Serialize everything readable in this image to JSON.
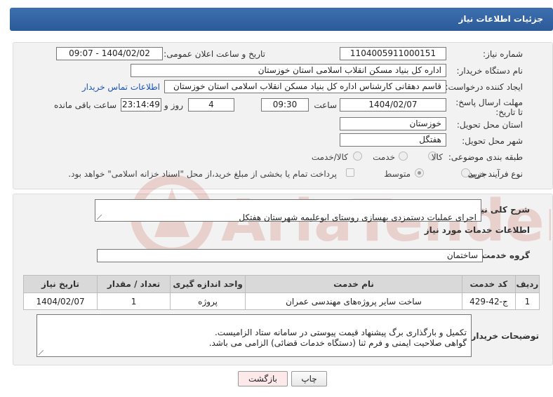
{
  "header": {
    "title": "جزئیات اطلاعات نیاز"
  },
  "form": {
    "need_number_label": "شماره نیاز:",
    "need_number": "1104005911000151",
    "announce_label": "تاریخ و ساعت اعلان عمومی:",
    "announce_value": "1404/02/02 - 09:07",
    "buyer_label": "نام دستگاه خریدار:",
    "buyer_value": "اداره کل بنیاد مسکن انقلاب اسلامی استان خوزستان",
    "creator_label": "ایجاد کننده درخواست:",
    "creator_value": "قاسم دهقانی کارشناس اداره کل بنیاد مسکن انقلاب اسلامی استان خوزستان",
    "contact_link": "اطلاعات تماس خریدار",
    "deadline_label": "مهلت ارسال پاسخ: تا تاریخ:",
    "deadline_date": "1404/02/07",
    "time_label": "ساعت",
    "deadline_time": "09:30",
    "days_value": "4",
    "days_label": "روز و",
    "remaining_value": "23:14:49",
    "remaining_label": "ساعت باقی مانده",
    "province_label": "استان محل تحویل:",
    "province_value": "خوزستان",
    "city_label": "شهر محل تحویل:",
    "city_value": "هفتگل",
    "category_label": "طبقه بندی موضوعی:",
    "category_options": [
      "کالا",
      "خدمت",
      "کالا/خدمت"
    ],
    "category_selected": "خدمت",
    "process_label": "نوع فرآیند خرید :",
    "process_options": [
      "جزیی",
      "متوسط"
    ],
    "process_selected": "متوسط",
    "payment_note": "پرداخت تمام یا بخشی از مبلغ خرید،از محل \"اسناد خزانه اسلامی\" خواهد بود."
  },
  "details": {
    "description_label": "شرح کلی نیاز:",
    "description_value": "اجرای عملیات دستمزدی بهسازی روستای ابوعلیمه شهرستان هفتکل",
    "services_heading": "اطلاعات خدمات مورد نیاز",
    "service_group_label": "گروه خدمت:",
    "service_group_value": "ساختمان",
    "table": {
      "headers": [
        "ردیف",
        "کد خدمت",
        "نام خدمت",
        "واحد اندازه گیری",
        "تعداد / مقدار",
        "تاریخ نیاز"
      ],
      "rows": [
        [
          "1",
          "ج-42-429",
          "ساخت سایر پروژه‌های مهندسی عمران",
          "پروژه",
          "1",
          "1404/02/07"
        ]
      ]
    },
    "buyer_notes_label": "توضیحات خریدار:",
    "buyer_notes_value": "تکمیل و بارگذاری برگ پیشنهاد قیمت پیوستی در سامانه ستاد الزامیست.\nگواهی صلاحیت ایمنی و فرم ثنا (دستگاه خدمات قضائی) الزامی می باشد."
  },
  "buttons": {
    "print": "چاپ",
    "back": "بازگشت"
  },
  "watermark_text": "AriaTender.net",
  "colors": {
    "header": "#2c5a99",
    "link": "#1a55b5",
    "back_button": "#fde8ea",
    "watermark": "#c0392b"
  }
}
